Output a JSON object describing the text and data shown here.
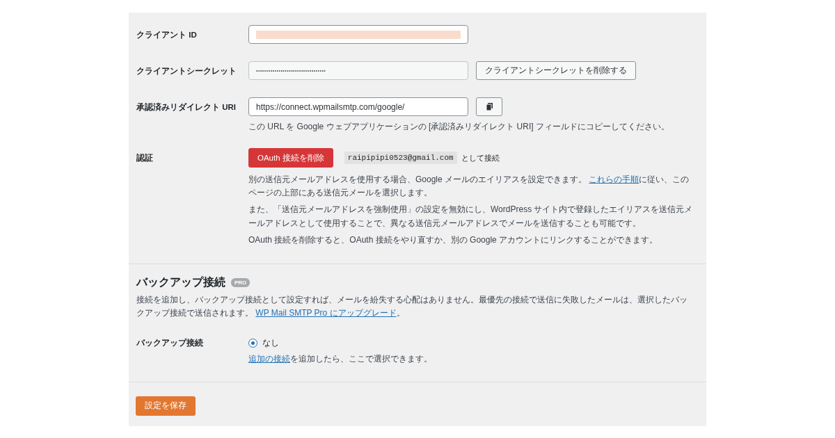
{
  "client_id": {
    "label": "クライアント ID",
    "redacted": true
  },
  "client_secret": {
    "label": "クライアントシークレット",
    "value": "••••••••••••••••••••••••••••••••••",
    "button": "クライアントシークレットを削除する"
  },
  "redirect_uri": {
    "label": "承認済みリダイレクト URI",
    "value": "https://connect.wpmailsmtp.com/google/",
    "description": "この URL を Google ウェブアプリケーションの [承認済みリダイレクト URI] フィールドにコピーしてください。"
  },
  "authorization": {
    "label": "認証",
    "button": "OAuth 接続を削除",
    "email": "raipipipi0523@gmail.com",
    "connected_as": "として接続",
    "paragraphs": [
      [
        {
          "kind": "text",
          "text": "別の送信元メールアドレスを使用する場合、Google メールのエイリアスを設定できます。 "
        },
        {
          "kind": "link",
          "text": "これらの手順"
        },
        {
          "kind": "text",
          "text": "に従い、このページの上部にある送信元メールを選択します。"
        }
      ],
      [
        {
          "kind": "text",
          "text": "また、「送信元メールアドレスを強制使用」の設定を無効にし、WordPress サイト内で登録したエイリアスを送信元メールアドレスとして使用することで、異なる送信元メールアドレスでメールを送信することも可能です。"
        }
      ],
      [
        {
          "kind": "text",
          "text": "OAuth 接続を削除すると、OAuth 接続をやり直すか、別の Google アカウントにリンクすることができます。"
        }
      ]
    ]
  },
  "backup_section": {
    "title": "バックアップ接続",
    "badge": "PRO",
    "description": [
      {
        "kind": "text",
        "text": "接続を追加し、バックアップ接続として設定すれば、メールを紛失する心配はありません。最優先の接続で送信に失敗したメールは、選択したバックアップ接続で送信されます。 "
      },
      {
        "kind": "link",
        "text": "WP Mail SMTP Pro にアップグレード"
      },
      {
        "kind": "text",
        "text": "。"
      }
    ],
    "label": "バックアップ接続",
    "options": [
      {
        "label": "なし",
        "selected": true
      }
    ],
    "hint": [
      {
        "kind": "link",
        "text": "追加の接続"
      },
      {
        "kind": "text",
        "text": "を追加したら、ここで選択できます。"
      }
    ]
  },
  "save_button": "設定を保存"
}
